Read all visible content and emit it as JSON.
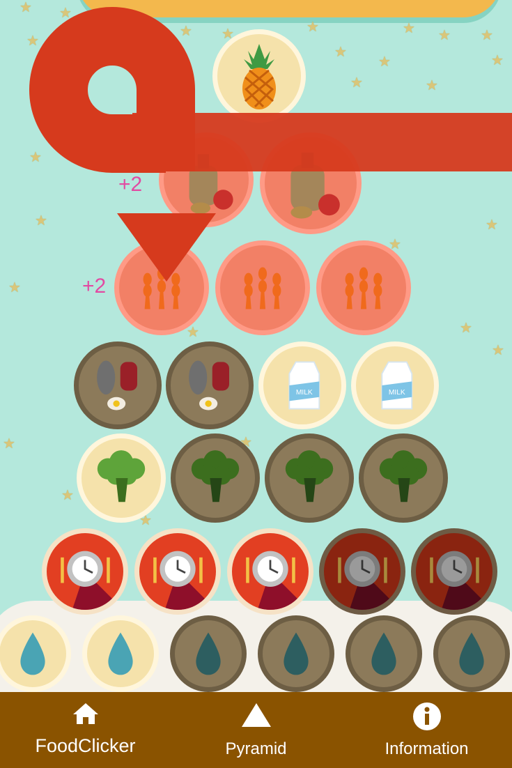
{
  "game": {
    "plus_labels": [
      "+2",
      "+2"
    ]
  },
  "tiers": [
    {
      "name": "fats-oils-sweets",
      "icon": "pineapple-icon",
      "coins": [
        "cream"
      ]
    },
    {
      "name": "oils-nuts",
      "icon": "oil-nuts-icon",
      "coins": [
        "salmon",
        "salmon"
      ]
    },
    {
      "name": "grains",
      "icon": "wheat-icon",
      "coins": [
        "salmon",
        "salmon",
        "salmon"
      ]
    },
    {
      "name": "protein-dairy",
      "icons": [
        "meat-fish-egg-icon",
        "milk-carton-icon"
      ],
      "coins": [
        "brown",
        "brown",
        "cream",
        "cream"
      ]
    },
    {
      "name": "vegetables",
      "icon": "broccoli-icon",
      "coins": [
        "cream",
        "brown",
        "brown",
        "brown"
      ]
    },
    {
      "name": "meals",
      "icon": "clock-plate-icon",
      "coins": [
        "red",
        "red",
        "red",
        "darkred",
        "darkred"
      ]
    },
    {
      "name": "water",
      "icon": "water-drop-icon",
      "coins": [
        "cream",
        "cream",
        "brown",
        "brown",
        "brown",
        "brown"
      ]
    }
  ],
  "milk_text": "MILK",
  "colors": {
    "background": "#b4e8dc",
    "nav_bar": "#8a5300",
    "overlay_arrow": "#d63a1d",
    "plus_text": "#e24aa2"
  },
  "nav": {
    "items": [
      {
        "label": "FoodClicker",
        "icon": "home-icon"
      },
      {
        "label": "Pyramid",
        "icon": "triangle-icon"
      },
      {
        "label": "Information",
        "icon": "info-icon"
      }
    ]
  }
}
